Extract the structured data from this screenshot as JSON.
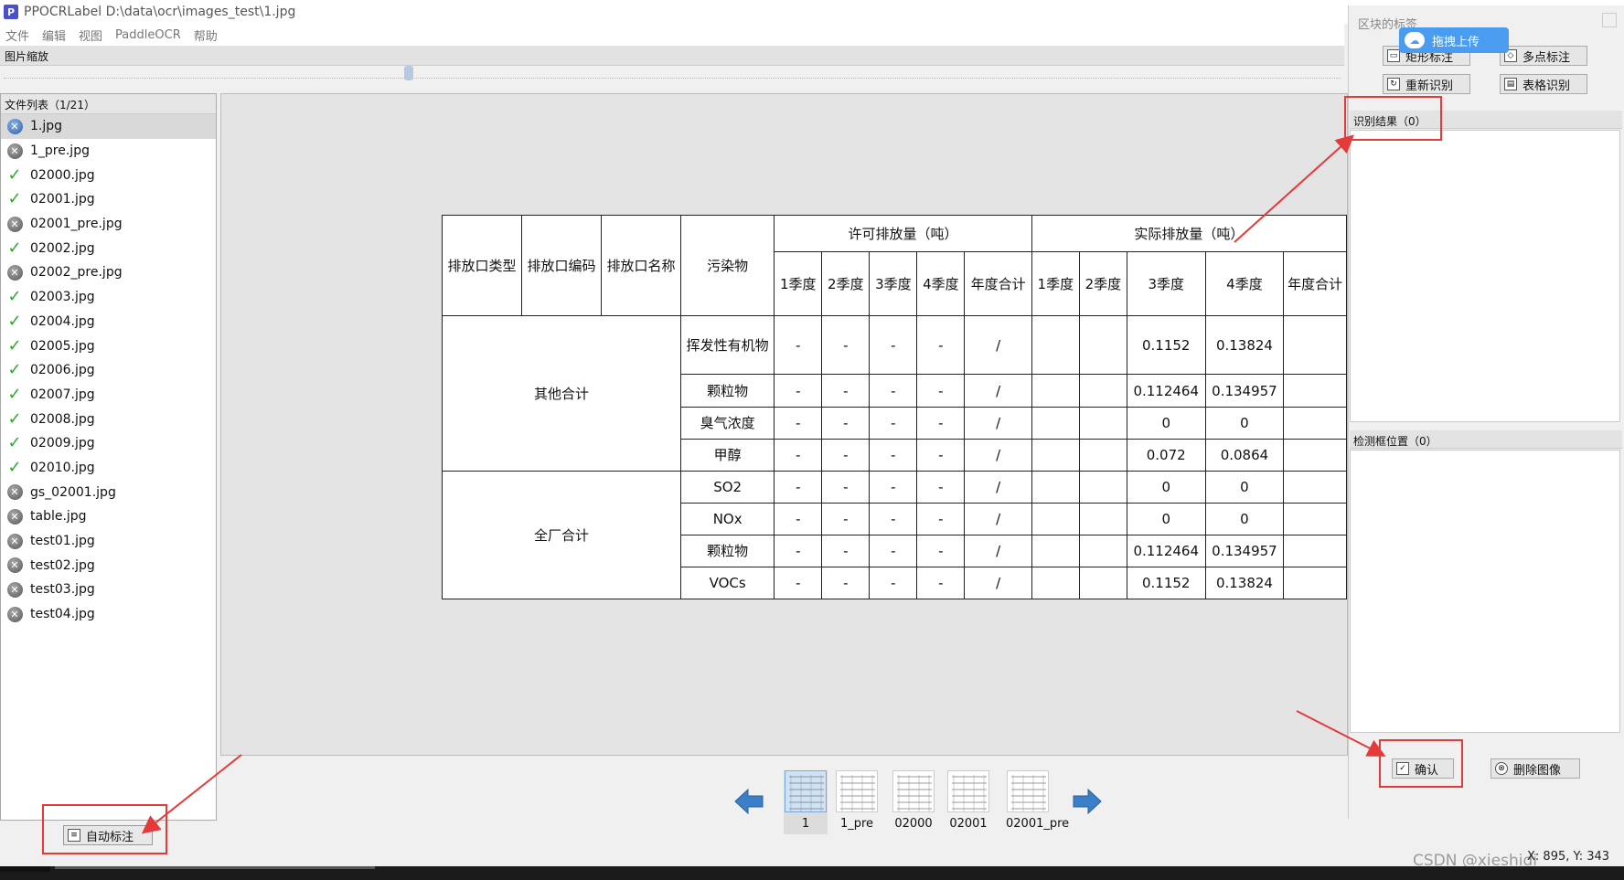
{
  "window": {
    "title": "PPOCRLabel D:\\data\\ocr\\images_test\\1.jpg",
    "icon_letter": "P"
  },
  "menu": [
    "文件",
    "编辑",
    "视图",
    "PaddleOCR",
    "帮助"
  ],
  "zoom_label": "图片缩放",
  "filelist": {
    "header": "文件列表（1/21）",
    "items": [
      {
        "name": "1.jpg",
        "status": "pending",
        "selected": true
      },
      {
        "name": "1_pre.jpg",
        "status": "pending"
      },
      {
        "name": "02000.jpg",
        "status": "done"
      },
      {
        "name": "02001.jpg",
        "status": "done"
      },
      {
        "name": "02001_pre.jpg",
        "status": "pending"
      },
      {
        "name": "02002.jpg",
        "status": "done"
      },
      {
        "name": "02002_pre.jpg",
        "status": "pending"
      },
      {
        "name": "02003.jpg",
        "status": "done"
      },
      {
        "name": "02004.jpg",
        "status": "done"
      },
      {
        "name": "02005.jpg",
        "status": "done"
      },
      {
        "name": "02006.jpg",
        "status": "done"
      },
      {
        "name": "02007.jpg",
        "status": "done"
      },
      {
        "name": "02008.jpg",
        "status": "done"
      },
      {
        "name": "02009.jpg",
        "status": "done"
      },
      {
        "name": "02010.jpg",
        "status": "done"
      },
      {
        "name": "gs_02001.jpg",
        "status": "pending"
      },
      {
        "name": "table.jpg",
        "status": "pending"
      },
      {
        "name": "test01.jpg",
        "status": "pending"
      },
      {
        "name": "test02.jpg",
        "status": "pending"
      },
      {
        "name": "test03.jpg",
        "status": "pending"
      },
      {
        "name": "test04.jpg",
        "status": "pending"
      }
    ]
  },
  "auto_label_button": "自动标注",
  "table": {
    "h_outlet_type": "排放口类型",
    "h_outlet_code": "排放口编码",
    "h_outlet_name": "排放口名称",
    "h_pollutant": "污染物",
    "h_permit": "许可排放量（吨）",
    "h_actual": "实际排放量（吨）",
    "permit_sub": [
      "1季度",
      "2季度",
      "3季度",
      "4季度",
      "年度合计"
    ],
    "actual_sub": [
      "1季度",
      "2季度",
      "3季度",
      "4季度",
      "年度合计"
    ],
    "group1": "其他合计",
    "group2": "全厂合计",
    "rows": [
      {
        "pollutant": "挥发性有机物",
        "permit": [
          "-",
          "-",
          "-",
          "-",
          "/"
        ],
        "actual": [
          "",
          "",
          "0.1152",
          "0.13824",
          ""
        ]
      },
      {
        "pollutant": "颗粒物",
        "permit": [
          "-",
          "-",
          "-",
          "-",
          "/"
        ],
        "actual": [
          "",
          "",
          "0.112464",
          "0.134957",
          ""
        ]
      },
      {
        "pollutant": "臭气浓度",
        "permit": [
          "-",
          "-",
          "-",
          "-",
          "/"
        ],
        "actual": [
          "",
          "",
          "0",
          "0",
          ""
        ]
      },
      {
        "pollutant": "甲醇",
        "permit": [
          "-",
          "-",
          "-",
          "-",
          "/"
        ],
        "actual": [
          "",
          "",
          "0.072",
          "0.0864",
          ""
        ]
      },
      {
        "pollutant": "SO2",
        "permit": [
          "-",
          "-",
          "-",
          "-",
          "/"
        ],
        "actual": [
          "",
          "",
          "0",
          "0",
          ""
        ]
      },
      {
        "pollutant": "NOx",
        "permit": [
          "-",
          "-",
          "-",
          "-",
          "/"
        ],
        "actual": [
          "",
          "",
          "0",
          "0",
          ""
        ]
      },
      {
        "pollutant": "颗粒物",
        "permit": [
          "-",
          "-",
          "-",
          "-",
          "/"
        ],
        "actual": [
          "",
          "",
          "0.112464",
          "0.134957",
          ""
        ]
      },
      {
        "pollutant": "VOCs",
        "permit": [
          "-",
          "-",
          "-",
          "-",
          "/"
        ],
        "actual": [
          "",
          "",
          "0.1152",
          "0.13824",
          ""
        ]
      }
    ]
  },
  "thumbnails": [
    "1",
    "1_pre",
    "02000",
    "02001",
    "02001_pre"
  ],
  "dock": {
    "title": "区块的标签",
    "upload_badge": "拖拽上传",
    "buttons": {
      "rect": "矩形标注",
      "multipoint": "多点标注",
      "rerecognize": "重新识别",
      "table_recognize": "表格识别"
    },
    "results_header": "识别结果（0）",
    "boxes_header": "检测框位置（0）",
    "confirm": "确认",
    "delete_image": "删除图像"
  },
  "status_text": "X: 895, Y: 343",
  "watermark": "CSDN @xieshidi"
}
